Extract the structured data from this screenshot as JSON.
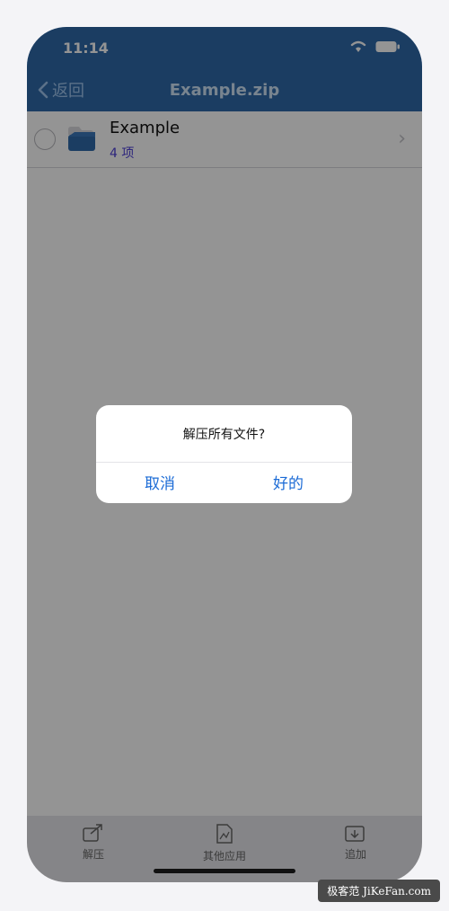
{
  "status_bar": {
    "time": "11:14"
  },
  "nav": {
    "back_label": "返回",
    "title": "Example.zip"
  },
  "list": {
    "items": [
      {
        "name": "Example",
        "count": "4 项"
      }
    ]
  },
  "alert": {
    "message": "解压所有文件?",
    "cancel_label": "取消",
    "ok_label": "好的"
  },
  "tab_bar": {
    "items": [
      {
        "label": "解压",
        "icon": "extract-icon"
      },
      {
        "label": "其他应用",
        "icon": "other-apps-icon"
      },
      {
        "label": "追加",
        "icon": "append-icon"
      }
    ]
  },
  "watermark": {
    "text": "极客范 JiKeFan.com"
  },
  "colors": {
    "nav": "#2f6aa9",
    "accent": "#1b6bd6",
    "count": "#4c3fd6"
  }
}
